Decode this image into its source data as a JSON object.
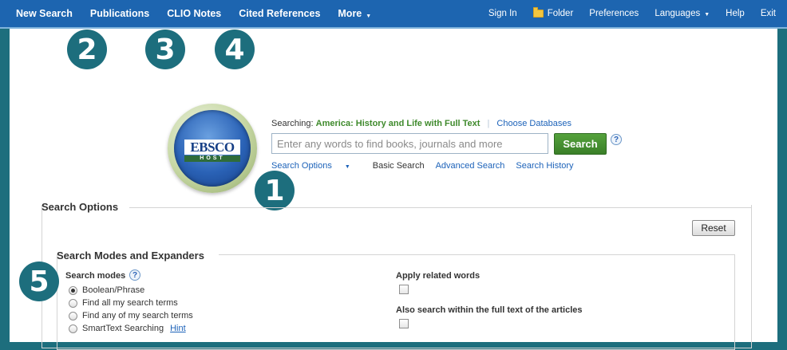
{
  "topbar": {
    "left": [
      {
        "label": "New Search"
      },
      {
        "label": "Publications"
      },
      {
        "label": "CLIO Notes"
      },
      {
        "label": "Cited References"
      },
      {
        "label": "More",
        "caret": "▼"
      }
    ],
    "right": {
      "sign_in": "Sign In",
      "folder": "Folder",
      "preferences": "Preferences",
      "languages": "Languages",
      "languages_caret": "▼",
      "help": "Help",
      "exit": "Exit"
    }
  },
  "badges": {
    "b1": "1",
    "b2": "2",
    "b3": "3",
    "b4": "4",
    "b5": "5"
  },
  "logo": {
    "word": "EBSCO",
    "sub": "HOST"
  },
  "search": {
    "searching_label": "Searching:",
    "database": "America: History and Life with Full Text",
    "choose_databases": "Choose Databases",
    "placeholder": "Enter any words to find books, journals and more",
    "value": "",
    "button": "Search",
    "help": "?",
    "options_link": "Search Options",
    "options_caret": "▼",
    "basic": "Basic Search",
    "advanced": "Advanced Search",
    "history": "Search History"
  },
  "options": {
    "title": "Search Options",
    "reset": "Reset",
    "modes_section_title": "Search Modes and Expanders",
    "search_modes_label": "Search modes",
    "help": "?",
    "modes": [
      {
        "label": "Boolean/Phrase",
        "selected": true
      },
      {
        "label": "Find all my search terms",
        "selected": false
      },
      {
        "label": "Find any of my search terms",
        "selected": false
      },
      {
        "label": "SmartText Searching",
        "selected": false
      }
    ],
    "hint": "Hint",
    "apply_related_words": "Apply related words",
    "full_text_search": "Also search within the full text of the articles"
  }
}
